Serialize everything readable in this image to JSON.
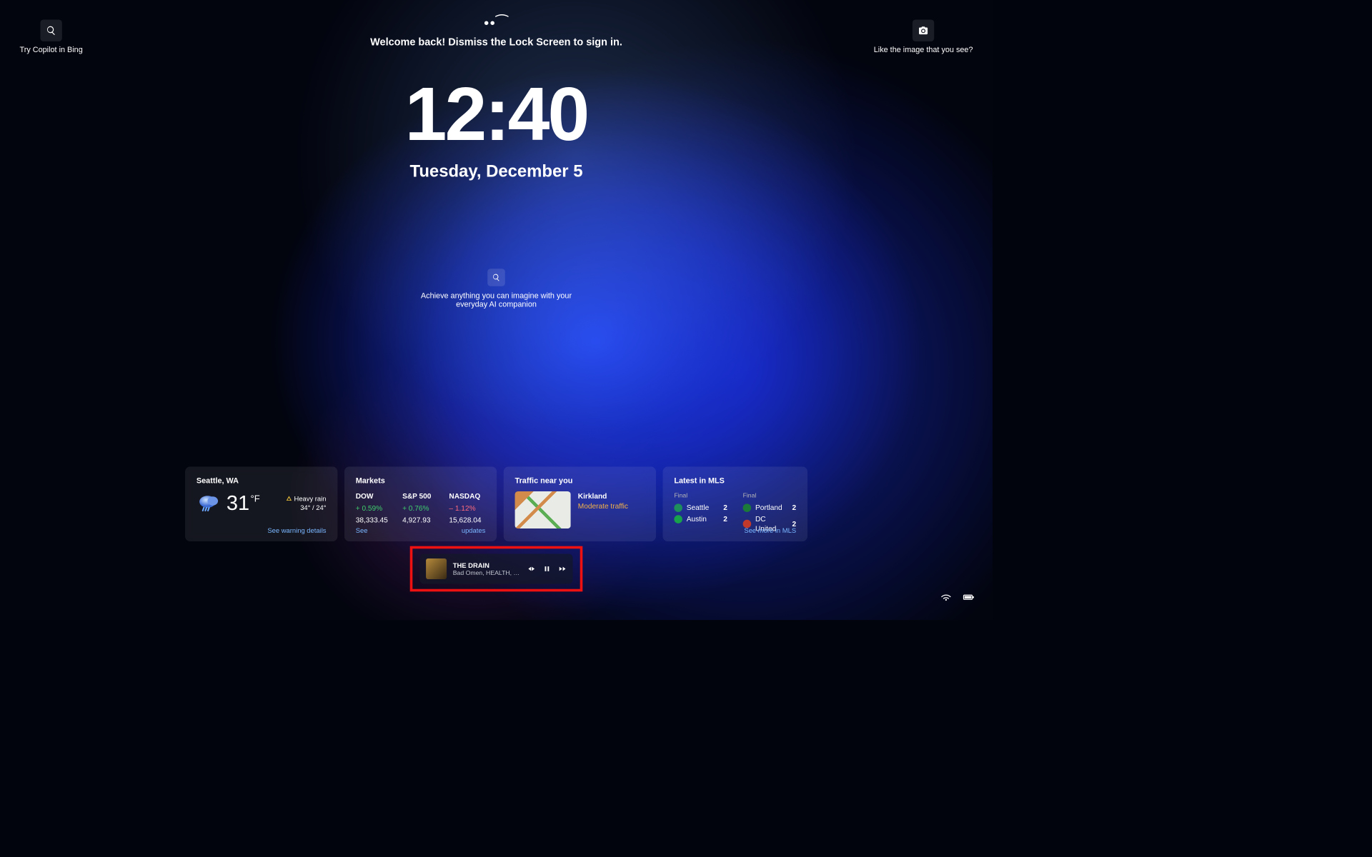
{
  "topLeft": {
    "label": "Try Copilot in Bing"
  },
  "topRight": {
    "label": "Like the image that you see?"
  },
  "center": {
    "welcome": "Welcome back! Dismiss the Lock Screen to sign in."
  },
  "clock": {
    "time": "12:40",
    "date": "Tuesday, December 5"
  },
  "aiPrompt": {
    "line1": "Achieve anything you can imagine with your",
    "line2": "everyday AI companion"
  },
  "weather": {
    "title": "Seattle, WA",
    "temp": "31",
    "unit": "°F",
    "condition": "Heavy rain",
    "hiLo": "34° /  24°",
    "link": "See warning details"
  },
  "markets": {
    "title": "Markets",
    "cols": [
      "DOW",
      "S&P 500",
      "NASDAQ"
    ],
    "pct": [
      "+ 0.59%",
      "+ 0.76%",
      "– 1.12%"
    ],
    "pctClass": [
      "pos",
      "pos",
      "neg"
    ],
    "val": [
      "38,333.45",
      "4,927.93",
      "15,628.04"
    ],
    "linkLeft": "See",
    "linkRight": "updates"
  },
  "traffic": {
    "title": "Traffic near you",
    "location": "Kirkland",
    "status": "Moderate traffic"
  },
  "sports": {
    "title": "Latest in MLS",
    "colHdr": "Final",
    "left": [
      {
        "team": "Seattle",
        "score": "2",
        "color": "#1e8e5c"
      },
      {
        "team": "Austin",
        "score": "2",
        "color": "#18a24b"
      }
    ],
    "right": [
      {
        "team": "Portland",
        "score": "2",
        "color": "#1b7a3a"
      },
      {
        "team": "DC United",
        "score": "2",
        "color": "#c0392b"
      }
    ],
    "link": "See more in MLS"
  },
  "media": {
    "title": "THE DRAIN",
    "artist": "Bad Omen, HEALTH, S…"
  }
}
